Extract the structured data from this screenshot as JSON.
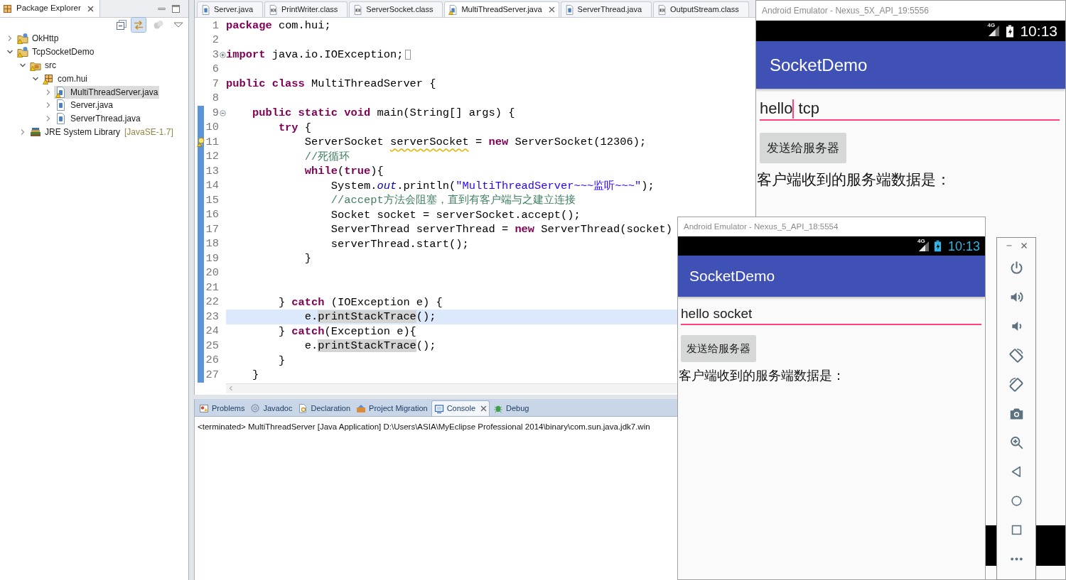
{
  "package_explorer": {
    "title": "Package Explorer",
    "toolbar": [
      {
        "kind": "collapse_all",
        "pressed": false,
        "disabled": false
      },
      {
        "kind": "link_with_editor",
        "pressed": true,
        "disabled": false
      },
      {
        "kind": "focus",
        "pressed": false,
        "disabled": true
      },
      {
        "kind": "view_menu",
        "pressed": false,
        "disabled": false
      }
    ],
    "tree": [
      {
        "label": "OkHttp",
        "kind": "project",
        "expanded": false,
        "selected": false,
        "warning": true
      },
      {
        "label": "TcpSocketDemo",
        "kind": "project",
        "expanded": true,
        "selected": false,
        "warning": true,
        "children": [
          {
            "label": "src",
            "kind": "source_folder",
            "expanded": true,
            "selected": false,
            "warning": true,
            "children": [
              {
                "label": "com.hui",
                "kind": "package",
                "expanded": true,
                "selected": false,
                "warning": true,
                "children": [
                  {
                    "label": "MultiThreadServer.java",
                    "kind": "java_file",
                    "expanded": false,
                    "selected": true,
                    "warning": true
                  },
                  {
                    "label": "Server.java",
                    "kind": "java_file",
                    "expanded": false,
                    "selected": false,
                    "warning": false
                  },
                  {
                    "label": "ServerThread.java",
                    "kind": "java_file",
                    "expanded": false,
                    "selected": false,
                    "warning": false
                  }
                ]
              }
            ]
          },
          {
            "label": "JRE System Library",
            "decoration": "[JavaSE-1.7]",
            "kind": "library",
            "expanded": false,
            "selected": false,
            "warning": false
          }
        ]
      }
    ]
  },
  "editor": {
    "tabs": [
      {
        "label": "Server.java",
        "kind": "java",
        "selected": false,
        "warning": false
      },
      {
        "label": "PrintWriter.class",
        "kind": "class",
        "selected": false,
        "warning": false
      },
      {
        "label": "ServerSocket.class",
        "kind": "class",
        "selected": false,
        "warning": false
      },
      {
        "label": "MultiThreadServer.java",
        "kind": "java",
        "selected": true,
        "warning": true
      },
      {
        "label": "ServerThread.java",
        "kind": "java",
        "selected": false,
        "warning": false
      },
      {
        "label": "OutputStream.class",
        "kind": "class",
        "selected": false,
        "warning": false
      }
    ],
    "lines": [
      {
        "number": "1",
        "changed": false,
        "current": false,
        "warning": false,
        "segments": [
          {
            "kind": "keyword",
            "text": "package"
          },
          {
            "kind": "text",
            "text": " com.hui;"
          }
        ]
      },
      {
        "number": "2",
        "changed": false,
        "current": false,
        "warning": false
      },
      {
        "number": "3",
        "changed": false,
        "current": false,
        "warning": false,
        "collapsed": true,
        "segments": [
          {
            "kind": "keyword",
            "text": "import"
          },
          {
            "kind": "text",
            "text": " java.io.IOException;"
          }
        ]
      },
      {
        "number": "6",
        "changed": false,
        "current": false,
        "warning": false
      },
      {
        "number": "7",
        "changed": false,
        "current": false,
        "warning": false,
        "segments": [
          {
            "kind": "keyword",
            "text": "public class"
          },
          {
            "kind": "text",
            "text": " MultiThreadServer {"
          }
        ]
      },
      {
        "number": "8",
        "changed": false,
        "current": false,
        "warning": false
      },
      {
        "number": "9",
        "changed": true,
        "current": false,
        "warning": false,
        "collapsed": false,
        "segments": [
          {
            "kind": "keyword",
            "text": "    public static void"
          },
          {
            "kind": "text",
            "text": " main(String[] args) {"
          }
        ]
      },
      {
        "number": "10",
        "changed": true,
        "current": false,
        "warning": false,
        "segments": [
          {
            "kind": "keyword",
            "text": "        try"
          },
          {
            "kind": "text",
            "text": " {"
          }
        ]
      },
      {
        "number": "11",
        "changed": true,
        "current": false,
        "warning": true,
        "segments": [
          {
            "kind": "text",
            "text": "            ServerSocket "
          },
          {
            "kind": "warning",
            "text": "serverSocket"
          },
          {
            "kind": "text",
            "text": " = "
          },
          {
            "kind": "keyword",
            "text": "new"
          },
          {
            "kind": "text",
            "text": " ServerSocket(12306);"
          }
        ]
      },
      {
        "number": "12",
        "changed": true,
        "current": false,
        "warning": false,
        "segments": [
          {
            "kind": "comment",
            "text": "            //死循环"
          }
        ]
      },
      {
        "number": "13",
        "changed": true,
        "current": false,
        "warning": false,
        "segments": [
          {
            "kind": "keyword",
            "text": "            while"
          },
          {
            "kind": "text",
            "text": "("
          },
          {
            "kind": "keyword",
            "text": "true"
          },
          {
            "kind": "text",
            "text": "){"
          }
        ]
      },
      {
        "number": "14",
        "changed": true,
        "current": false,
        "warning": false,
        "segments": [
          {
            "kind": "text",
            "text": "                System."
          },
          {
            "kind": "static_field",
            "text": "out"
          },
          {
            "kind": "text",
            "text": ".println("
          },
          {
            "kind": "string",
            "text": "\"MultiThreadServer~~~监听~~~\""
          },
          {
            "kind": "text",
            "text": ");"
          }
        ]
      },
      {
        "number": "15",
        "changed": true,
        "current": false,
        "warning": false,
        "segments": [
          {
            "kind": "comment",
            "text": "                //accept方法会阻塞，直到有客户端与之建立连接"
          }
        ]
      },
      {
        "number": "16",
        "changed": true,
        "current": false,
        "warning": false,
        "segments": [
          {
            "kind": "text",
            "text": "                Socket socket = serverSocket.accept();"
          }
        ]
      },
      {
        "number": "17",
        "changed": true,
        "current": false,
        "warning": false,
        "segments": [
          {
            "kind": "text",
            "text": "                ServerThread serverThread = "
          },
          {
            "kind": "keyword",
            "text": "new"
          },
          {
            "kind": "text",
            "text": " ServerThread(socket)"
          }
        ]
      },
      {
        "number": "18",
        "changed": true,
        "current": false,
        "warning": false,
        "segments": [
          {
            "kind": "text",
            "text": "                serverThread.start();"
          }
        ]
      },
      {
        "number": "19",
        "changed": true,
        "current": false,
        "warning": false,
        "segments": [
          {
            "kind": "text",
            "text": "            }"
          }
        ]
      },
      {
        "number": "20",
        "changed": true,
        "current": false,
        "warning": false
      },
      {
        "number": "21",
        "changed": true,
        "current": false,
        "warning": false
      },
      {
        "number": "22",
        "changed": true,
        "current": false,
        "warning": false,
        "segments": [
          {
            "kind": "text",
            "text": "        } "
          },
          {
            "kind": "keyword",
            "text": "catch"
          },
          {
            "kind": "text",
            "text": " (IOException e) {"
          }
        ]
      },
      {
        "number": "23",
        "changed": true,
        "current": true,
        "warning": false,
        "segments": [
          {
            "kind": "text",
            "text": "            e."
          },
          {
            "kind": "occurrence",
            "text": "printStackTrace"
          },
          {
            "kind": "text",
            "text": "();"
          }
        ]
      },
      {
        "number": "24",
        "changed": true,
        "current": false,
        "warning": false,
        "segments": [
          {
            "kind": "text",
            "text": "        } "
          },
          {
            "kind": "keyword",
            "text": "catch"
          },
          {
            "kind": "text",
            "text": "(Exception e){"
          }
        ]
      },
      {
        "number": "25",
        "changed": true,
        "current": false,
        "warning": false,
        "segments": [
          {
            "kind": "text",
            "text": "            e."
          },
          {
            "kind": "occurrence",
            "text": "printStackTrace"
          },
          {
            "kind": "text",
            "text": "();"
          }
        ]
      },
      {
        "number": "26",
        "changed": true,
        "current": false,
        "warning": false,
        "segments": [
          {
            "kind": "text",
            "text": "        }"
          }
        ]
      },
      {
        "number": "27",
        "changed": true,
        "current": false,
        "warning": false,
        "segments": [
          {
            "kind": "text",
            "text": "    }"
          }
        ]
      }
    ]
  },
  "console": {
    "tabs": [
      {
        "label": "Problems",
        "kind": "problems",
        "selected": false
      },
      {
        "label": "Javadoc",
        "kind": "javadoc",
        "selected": false
      },
      {
        "label": "Declaration",
        "kind": "declaration",
        "selected": false
      },
      {
        "label": "Project Migration",
        "kind": "migration",
        "selected": false
      },
      {
        "label": "Console",
        "kind": "console",
        "selected": true
      },
      {
        "label": "Debug",
        "kind": "debug",
        "selected": false
      }
    ],
    "output": "<terminated> MultiThreadServer [Java Application] D:\\Users\\ASIA\\MyEclipse Professional 2014\\binary\\com.sun.java.jdk7.win"
  },
  "emulators": [
    {
      "title": "Android Emulator - Nexus_5X_API_19:5556",
      "status_bar": {
        "network": "4G",
        "time": "10:13",
        "color": "#ffffff"
      },
      "app_title": "SocketDemo",
      "field": {
        "value": "hello",
        "caret": true,
        "after_caret": " tcp"
      },
      "button": "发送给服务器",
      "label": "客户端收到的服务端数据是："
    },
    {
      "title": "Android Emulator - Nexus_5_API_18:5554",
      "status_bar": {
        "network": "4G",
        "time": "10:13",
        "color": "#33b5e5"
      },
      "app_title": "SocketDemo",
      "field": {
        "value": "hello socket",
        "caret": false
      },
      "button": "发送给服务器",
      "label": "客户端收到的服务端数据是：",
      "toolbar": [
        {
          "kind": "minimize"
        },
        {
          "kind": "close"
        },
        {
          "kind": "power"
        },
        {
          "kind": "volume_up"
        },
        {
          "kind": "volume_down"
        },
        {
          "kind": "rotate_left"
        },
        {
          "kind": "rotate_right"
        },
        {
          "kind": "screenshot"
        },
        {
          "kind": "zoom"
        },
        {
          "kind": "back"
        },
        {
          "kind": "home"
        },
        {
          "kind": "overview"
        },
        {
          "kind": "more"
        }
      ]
    }
  ]
}
